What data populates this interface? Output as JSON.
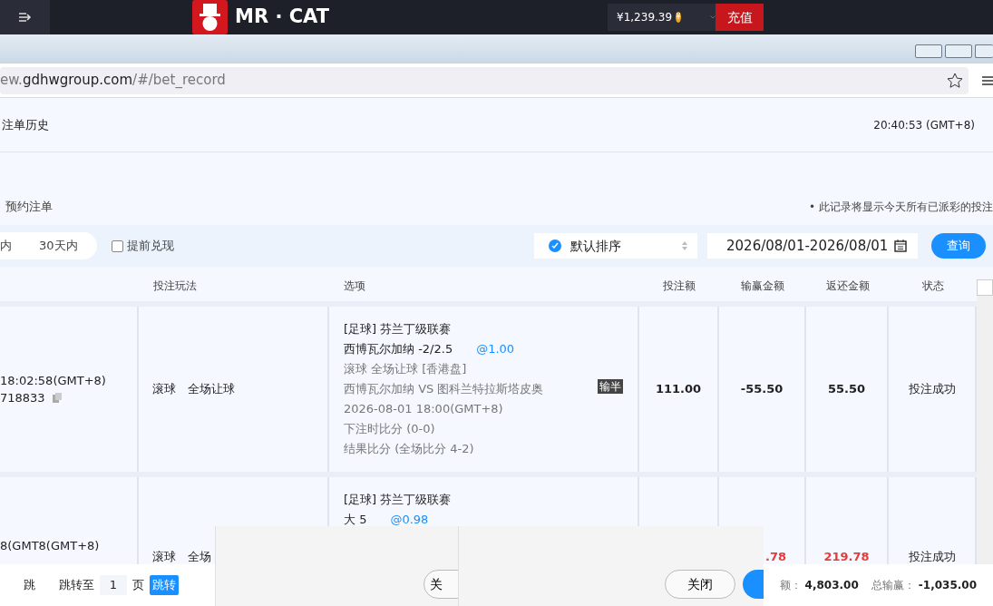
{
  "top_bar": {
    "brand": "MR · CAT",
    "balance": "¥1,239.39",
    "coin": "¥",
    "recharge": "充值"
  },
  "browser": {
    "url_prefix": "ew.",
    "url_host": "gdhwgroup.com",
    "url_path": "/#/bet_record"
  },
  "page": {
    "title": "注单历史",
    "clock": "20:40:53 (GMT+8)"
  },
  "tabs": [
    {
      "label": "预约注单",
      "selected": false
    }
  ],
  "note": "• 此记录将显示今天所有已派彩的投注",
  "filters": {
    "ranges": [
      {
        "label": "内",
        "selected": false
      },
      {
        "label": "30天内",
        "selected": false
      }
    ],
    "early_cashout": {
      "label": "提前兑现",
      "checked": false
    },
    "sort": {
      "label": "默认排序",
      "checked": true
    },
    "date_range": "2026/08/01-2026/08/01",
    "query": "查询"
  },
  "table": {
    "columns": [
      "投注玩法",
      "选项",
      "投注额",
      "输赢金额",
      "返还金额",
      "状态"
    ],
    "rows": [
      {
        "time": "18:02:58(GMT+8)",
        "order_no": "718833",
        "play": [
          "滚球",
          "全场让球"
        ],
        "league": "[足球] 芬兰丁级联赛",
        "pick": "西博瓦尔加纳 -2/2.5",
        "odds": "@1.00",
        "details": [
          "滚球 全场让球 [香港盘]",
          "西博瓦尔加纳 VS 图科兰特拉斯塔皮奥",
          "2026-08-01 18:00(GMT+8)",
          "下注时比分 (0-0)",
          "结果比分 (全场比分 4-2)"
        ],
        "result_tag": "输半",
        "stake": "111.00",
        "win_loss": "-55.50",
        "returned": "55.50",
        "status": "投注成功",
        "won": false
      },
      {
        "time": "8(GMT8(GMT+8)",
        "play": [
          "滚球",
          "全场"
        ],
        "league": "[足球] 芬兰丁级联赛",
        "pick": "大 5",
        "odds": "@0.98",
        "win_loss": ".78",
        "returned": "219.78",
        "status": "投注成功",
        "won": true
      }
    ]
  },
  "footer": {
    "jump_cut": "跳",
    "jump_to": "跳转至",
    "page": "1",
    "page_unit": "页",
    "jump": "跳转",
    "stake_label": "额：",
    "stake_total": "4,803.00",
    "win_label": "总输赢：",
    "win_total": "-1,035.00"
  },
  "dialogs": [
    {
      "button": "关"
    },
    {
      "button": "关闭"
    }
  ]
}
